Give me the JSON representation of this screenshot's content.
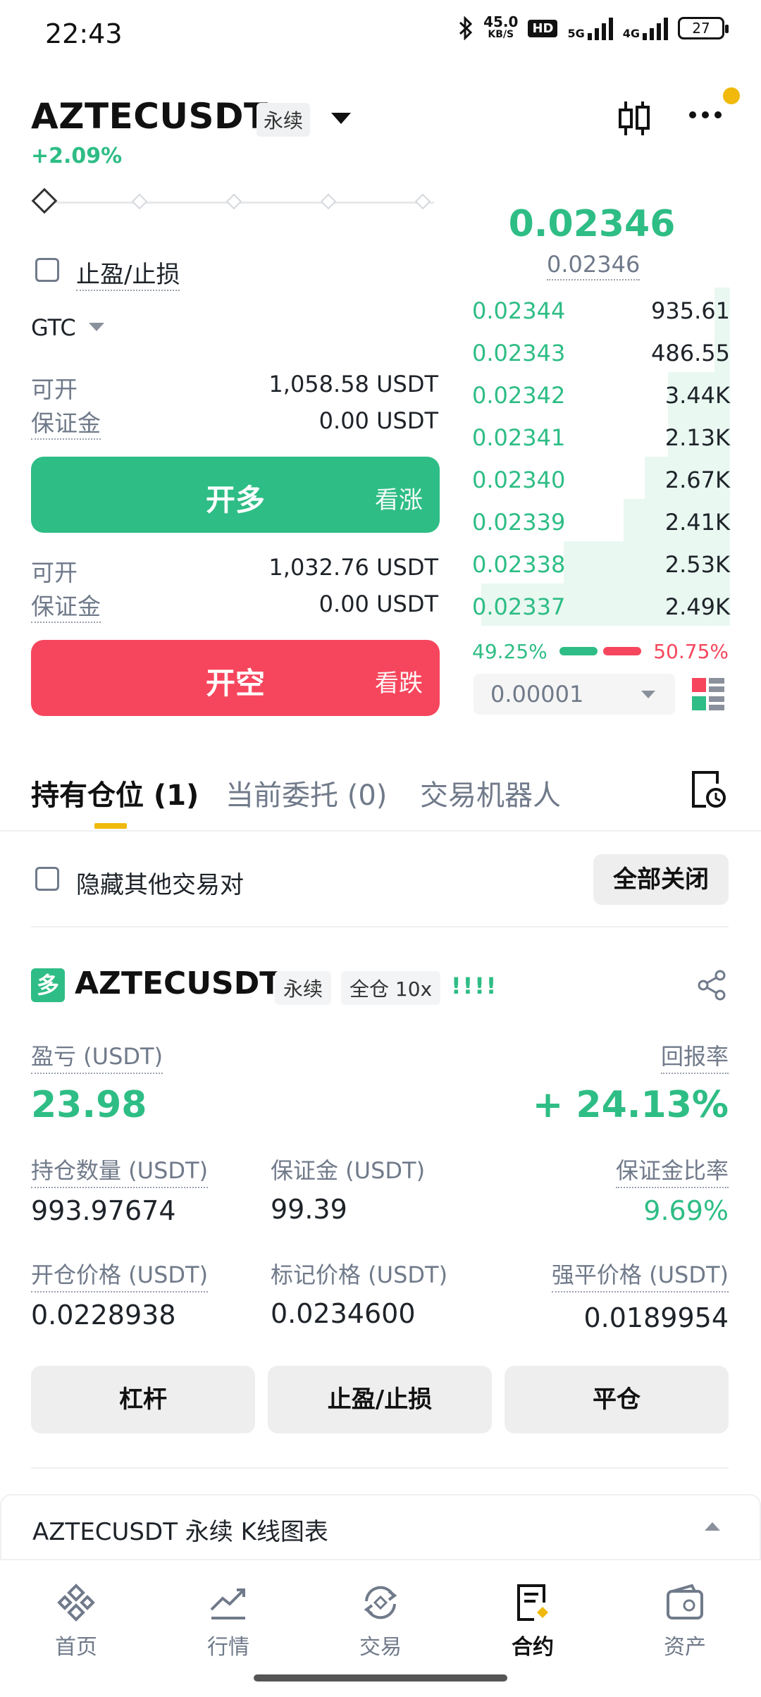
{
  "status_bar": {
    "time": "22:43",
    "speed_value": "45.0",
    "speed_unit": "KB/S",
    "hd": "HD",
    "net1": "5G",
    "net2": "4G",
    "battery": "27"
  },
  "header": {
    "pair": "AZTECUSDT",
    "contract_type": "永续",
    "change": "+2.09%",
    "icons": [
      "candlestick-icon",
      "more-icon"
    ]
  },
  "order_form": {
    "tpsl_label": "止盈/止损",
    "time_in_force": "GTC",
    "long": {
      "available_label": "可开",
      "available_value": "1,058.58 USDT",
      "margin_label": "保证金",
      "margin_value": "0.00 USDT",
      "button_label": "开多",
      "button_sub": "看涨"
    },
    "short": {
      "available_label": "可开",
      "available_value": "1,032.76 USDT",
      "margin_label": "保证金",
      "margin_value": "0.00 USDT",
      "button_label": "开空",
      "button_sub": "看跌"
    }
  },
  "order_book": {
    "last_price": "0.02346",
    "mark_price": "0.02346",
    "bids": [
      {
        "price": "0.02344",
        "qty": "935.61",
        "depth": 0.06
      },
      {
        "price": "0.02343",
        "qty": "486.55",
        "depth": 0.06
      },
      {
        "price": "0.02342",
        "qty": "3.44K",
        "depth": 0.24
      },
      {
        "price": "0.02341",
        "qty": "2.13K",
        "depth": 0.24
      },
      {
        "price": "0.02340",
        "qty": "2.67K",
        "depth": 0.33
      },
      {
        "price": "0.02339",
        "qty": "2.41K",
        "depth": 0.41
      },
      {
        "price": "0.02338",
        "qty": "2.53K",
        "depth": 0.64
      },
      {
        "price": "0.02337",
        "qty": "2.49K",
        "depth": 0.96
      }
    ],
    "buy_ratio": "49.25%",
    "sell_ratio": "50.75%",
    "precision": "0.00001",
    "colors": {
      "buy": "#2ebd85",
      "sell": "#f6465d"
    }
  },
  "tabs": [
    {
      "label": "持有仓位 (1)",
      "active": true
    },
    {
      "label": "当前委托 (0)",
      "active": false
    },
    {
      "label": "交易机器人",
      "active": false
    }
  ],
  "positions_toolbar": {
    "hide_label": "隐藏其他交易对",
    "close_all": "全部关闭"
  },
  "position": {
    "side_badge": "多",
    "symbol": "AZTECUSDT",
    "contract_type": "永续",
    "margin_mode": "全仓 10x",
    "bars": "!!!!",
    "pnl_label": "盈亏 (USDT)",
    "pnl_value": "23.98",
    "roe_label": "回报率",
    "roe_value": "+ 24.13%",
    "size_label": "持仓数量 (USDT)",
    "size_value": "993.97674",
    "margin_label": "保证金 (USDT)",
    "margin_value": "99.39",
    "margin_ratio_label": "保证金比率",
    "margin_ratio_value": "9.69%",
    "entry_label": "开仓价格 (USDT)",
    "entry_value": "0.0228938",
    "mark_label": "标记价格 (USDT)",
    "mark_value": "0.0234600",
    "liq_label": "强平价格 (USDT)",
    "liq_value": "0.0189954",
    "actions": [
      "杠杆",
      "止盈/止损",
      "平仓"
    ]
  },
  "kline_bar": {
    "label": "AZTECUSDT 永续 K线图表"
  },
  "bottom_nav": [
    {
      "label": "首页",
      "icon": "binance-logo-icon",
      "active": false
    },
    {
      "label": "行情",
      "icon": "chart-icon",
      "active": false
    },
    {
      "label": "交易",
      "icon": "exchange-icon",
      "active": false
    },
    {
      "label": "合约",
      "icon": "futures-icon",
      "active": true
    },
    {
      "label": "资产",
      "icon": "wallet-icon",
      "active": false
    }
  ],
  "accent_color": "#f0b90b"
}
